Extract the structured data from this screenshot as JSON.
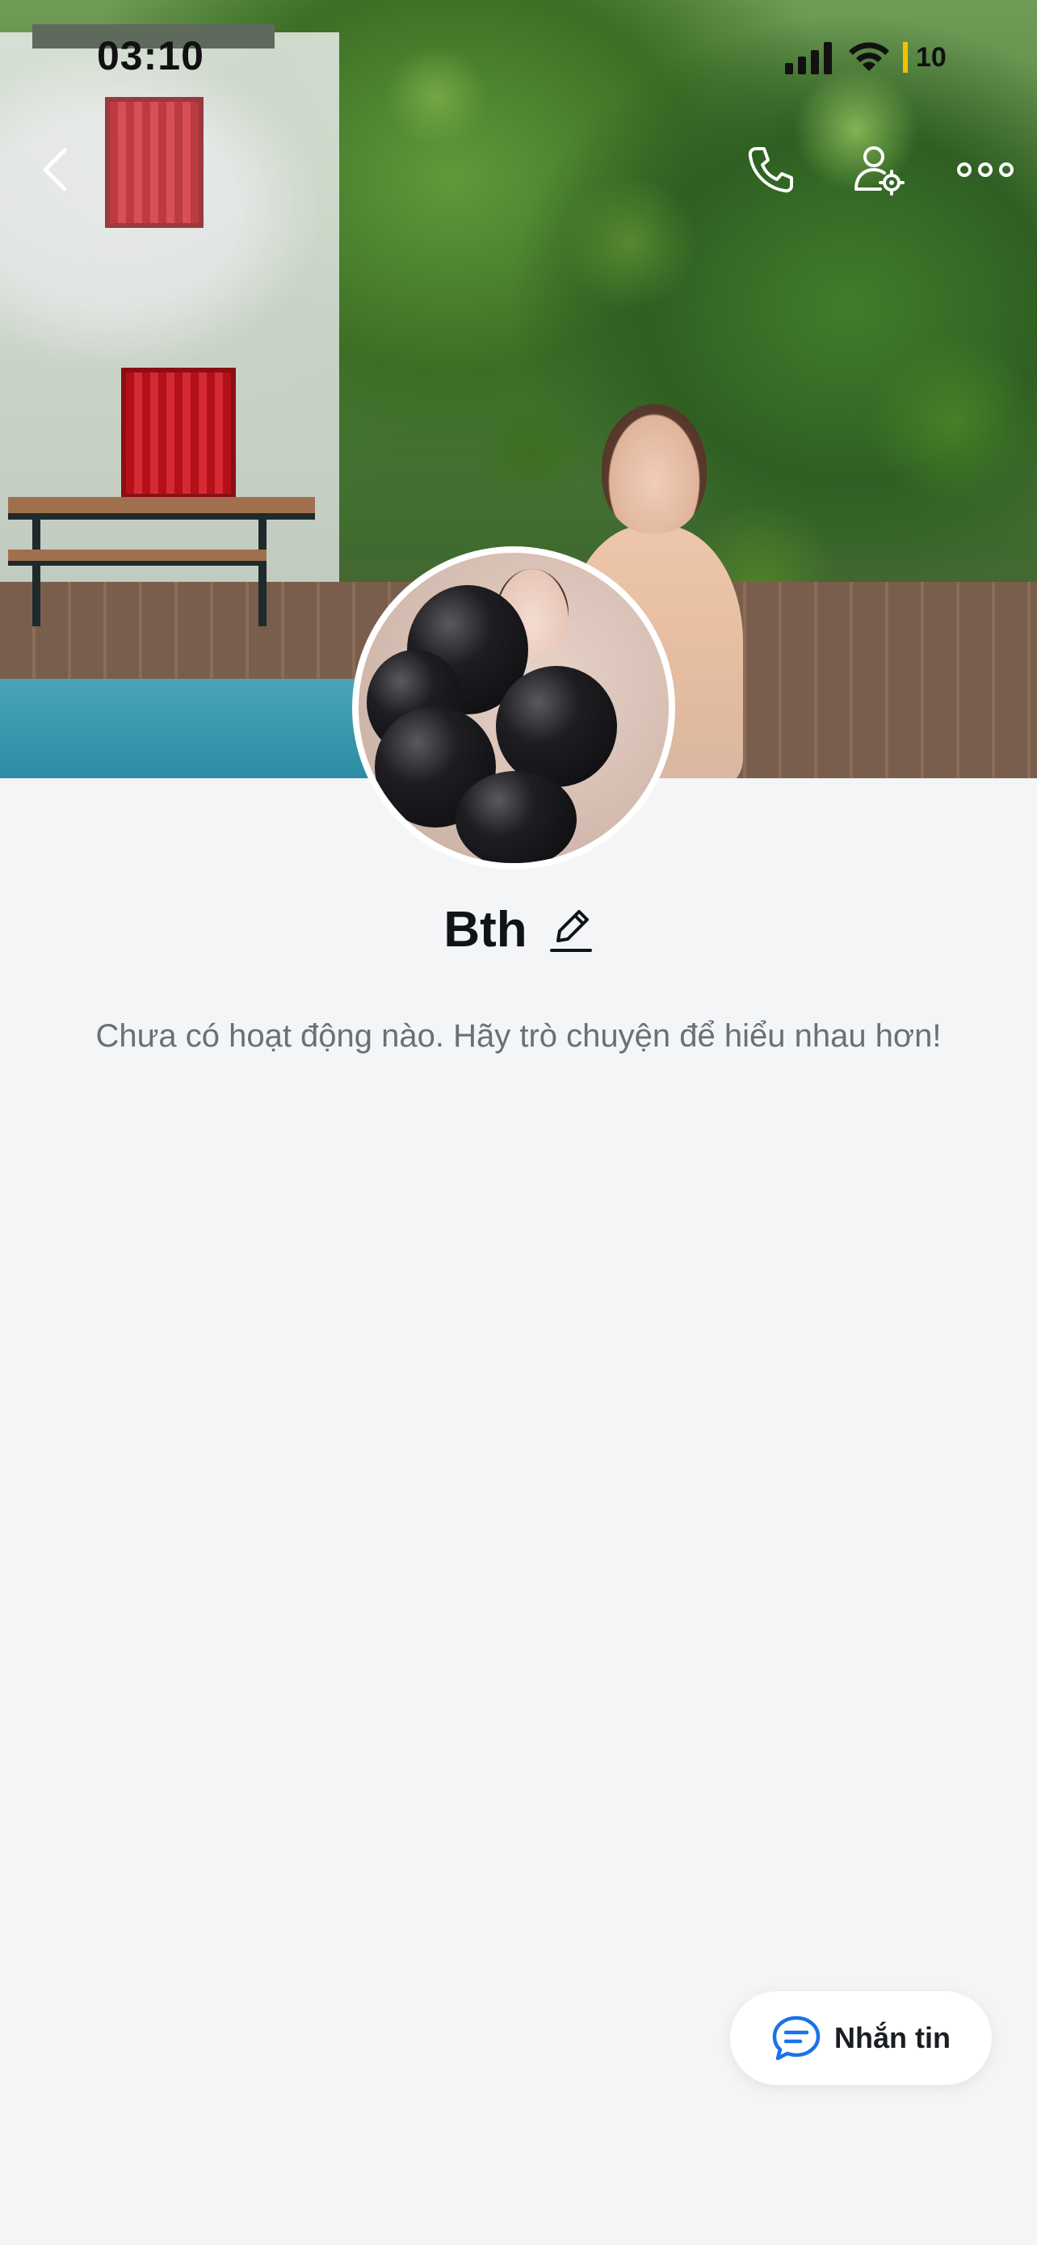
{
  "status_bar": {
    "time": "03:10",
    "battery_level": "10"
  },
  "nav": {
    "back_icon": "chevron-left-icon",
    "call_icon": "phone-icon",
    "user_settings_icon": "user-gear-icon",
    "more_icon": "more-horizontal-icon"
  },
  "profile": {
    "name": "Bth",
    "edit_icon": "pencil-icon",
    "empty_activity_text": "Chưa có hoạt động nào. Hãy trò chuyện để hiểu nhau hơn!"
  },
  "actions": {
    "message_label": "Nhắn tin",
    "message_icon": "chat-bubble-icon"
  },
  "colors": {
    "background": "#f4f5f7",
    "accent_blue": "#1a73e8",
    "battery_low": "#f2c200"
  }
}
